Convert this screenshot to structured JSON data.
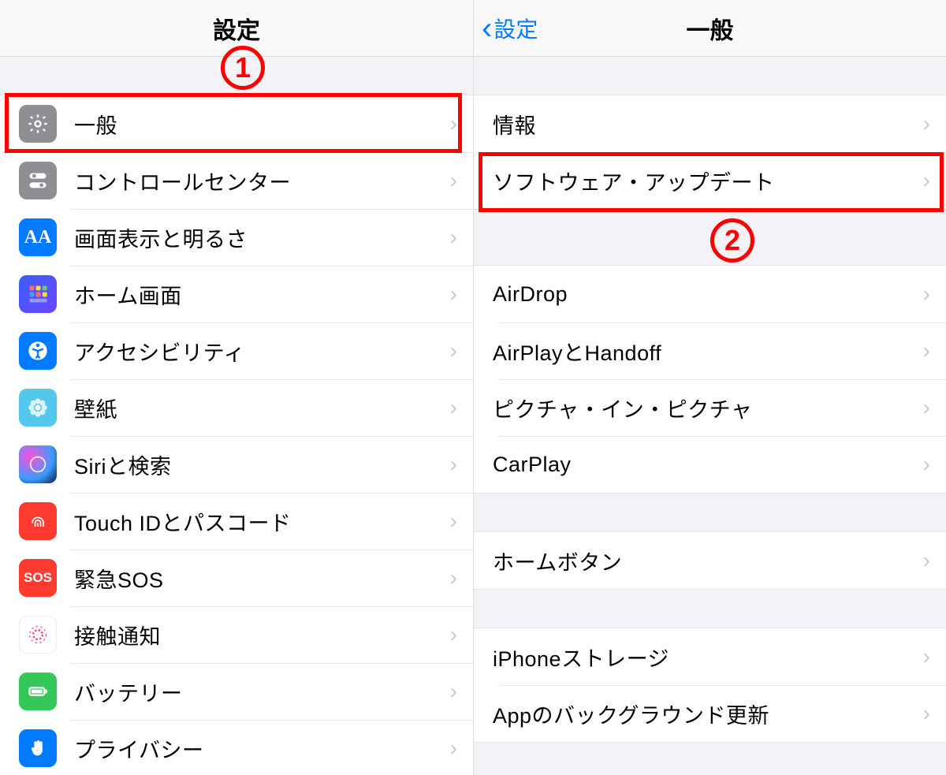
{
  "left": {
    "title": "設定",
    "items": [
      {
        "label": "一般"
      },
      {
        "label": "コントロールセンター"
      },
      {
        "label": "画面表示と明るさ"
      },
      {
        "label": "ホーム画面"
      },
      {
        "label": "アクセシビリティ"
      },
      {
        "label": "壁紙"
      },
      {
        "label": "Siriと検索"
      },
      {
        "label": "Touch IDとパスコード"
      },
      {
        "label": "緊急SOS"
      },
      {
        "label": "接触通知"
      },
      {
        "label": "バッテリー"
      },
      {
        "label": "プライバシー"
      }
    ],
    "sos_text": "SOS"
  },
  "right": {
    "back_label": "設定",
    "title": "一般",
    "section1": [
      {
        "label": "情報"
      },
      {
        "label": "ソフトウェア・アップデート"
      }
    ],
    "section2": [
      {
        "label": "AirDrop"
      },
      {
        "label": "AirPlayとHandoff"
      },
      {
        "label": "ピクチャ・イン・ピクチャ"
      },
      {
        "label": "CarPlay"
      }
    ],
    "section3": [
      {
        "label": "ホームボタン"
      }
    ],
    "section4": [
      {
        "label": "iPhoneストレージ"
      },
      {
        "label": "Appのバックグラウンド更新"
      }
    ]
  },
  "annotations": {
    "one": "1",
    "two": "2"
  }
}
